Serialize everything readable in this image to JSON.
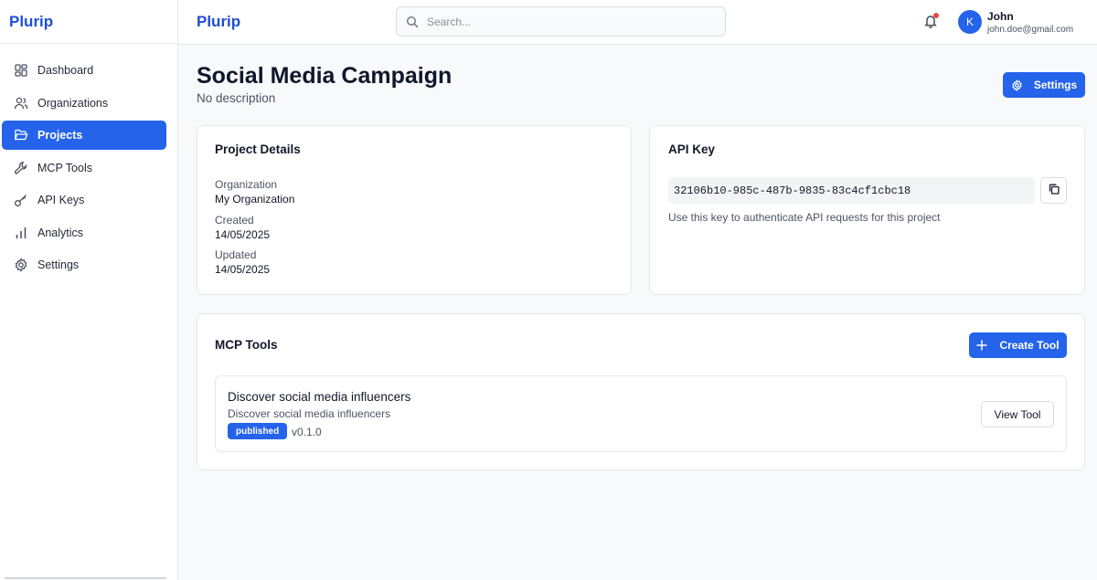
{
  "sidebar": {
    "brand": "Plurip",
    "items": [
      {
        "label": "Dashboard",
        "icon": "grid-icon",
        "active": false
      },
      {
        "label": "Organizations",
        "icon": "users-icon",
        "active": false
      },
      {
        "label": "Projects",
        "icon": "folder-open-icon",
        "active": true
      },
      {
        "label": "MCP Tools",
        "icon": "wrench-icon",
        "active": false
      },
      {
        "label": "API Keys",
        "icon": "key-icon",
        "active": false
      },
      {
        "label": "Analytics",
        "icon": "bar-chart-icon",
        "active": false
      },
      {
        "label": "Settings",
        "icon": "gear-icon",
        "active": false
      }
    ]
  },
  "header": {
    "brand": "Plurip",
    "search": {
      "placeholder": "Search...",
      "value": ""
    },
    "user": {
      "initial": "K",
      "name": "John",
      "email": "john.doe@gmail.com"
    },
    "notification_dot_color": "#ef4444"
  },
  "page": {
    "title": "Social Media Campaign",
    "subtitle": "No description",
    "settings_label": "Settings"
  },
  "project_details": {
    "title": "Project Details",
    "fields": [
      {
        "label": "Organization",
        "value": "My Organization"
      },
      {
        "label": "Created",
        "value": "14/05/2025"
      },
      {
        "label": "Updated",
        "value": "14/05/2025"
      }
    ]
  },
  "api_key": {
    "title": "API Key",
    "key": "32106b10-985c-487b-9835-83c4cf1cbc18",
    "help": "Use this key to authenticate API requests for this project"
  },
  "mcp_tools": {
    "title": "MCP Tools",
    "create_label": "Create Tool",
    "tools": [
      {
        "name": "Discover social media influencers",
        "description": "Discover social media influencers",
        "status": "published",
        "version": "v0.1.0",
        "view_label": "View Tool"
      }
    ]
  },
  "colors": {
    "accent": "#2563eb",
    "brand": "#1d4ed8"
  }
}
